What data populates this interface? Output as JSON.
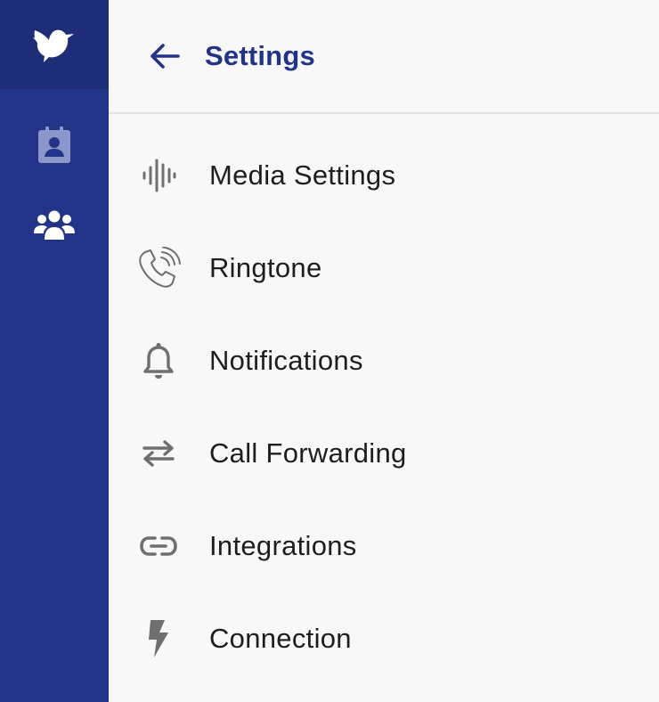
{
  "sidebar": {
    "logo_icon": "bird-logo-icon",
    "items": [
      {
        "id": "contacts",
        "icon": "contact-card-icon"
      },
      {
        "id": "team",
        "icon": "users-group-icon"
      }
    ]
  },
  "header": {
    "back_icon": "arrow-left-icon",
    "title": "Settings"
  },
  "menu": {
    "items": [
      {
        "label": "Media Settings",
        "icon": "audio-waveform-icon"
      },
      {
        "label": "Ringtone",
        "icon": "phone-ringing-icon"
      },
      {
        "label": "Notifications",
        "icon": "bell-icon"
      },
      {
        "label": "Call Forwarding",
        "icon": "swap-arrows-icon"
      },
      {
        "label": "Integrations",
        "icon": "link-icon"
      },
      {
        "label": "Connection",
        "icon": "lightning-bolt-icon"
      }
    ]
  },
  "colors": {
    "sidebar": "#22348a",
    "sidebar_logo_bg": "#1f2d78",
    "accent": "#22348a",
    "icon_gray": "#6f6f6f",
    "text": "#1e1e1e",
    "background": "#f8f8f8"
  }
}
